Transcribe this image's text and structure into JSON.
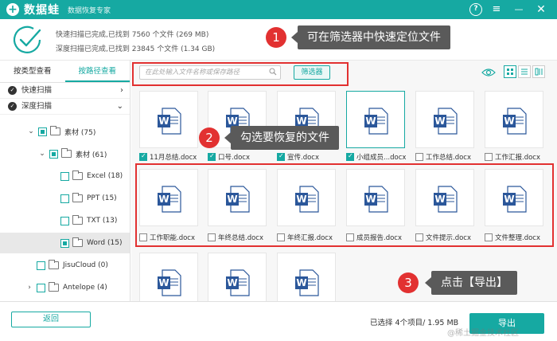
{
  "app": {
    "name": "数据蛙",
    "subtitle": "数据恢复专家"
  },
  "window_controls": {
    "help": "?",
    "menu": "≡",
    "minimize": "—",
    "close": "✕"
  },
  "summary": {
    "quick_scan": "快速扫描已完成,已找到 7560 个文件 (269 MB)",
    "deep_scan": "深度扫描已完成,已找到 23845 个文件 (1.34 GB)"
  },
  "callouts": [
    {
      "number": "1",
      "text": "可在筛选器中快速定位文件"
    },
    {
      "number": "2",
      "text": "勾选要恢复的文件"
    },
    {
      "number": "3",
      "text": "点击【导出】"
    }
  ],
  "left": {
    "tabs": [
      "按类型查看",
      "按路径查看"
    ],
    "active_tab": 1,
    "scans": [
      {
        "label": "快速扫描",
        "chevron": "›"
      },
      {
        "label": "深度扫描",
        "chevron": "⌄"
      }
    ],
    "tree": [
      {
        "label": "素材 (75)",
        "arrow": "⌄",
        "state": "partial"
      },
      {
        "label": "素材 (61)",
        "arrow": "⌄",
        "state": "partial"
      },
      {
        "label": "Excel (18)",
        "arrow": "",
        "state": "none"
      },
      {
        "label": "PPT (15)",
        "arrow": "",
        "state": "none"
      },
      {
        "label": "TXT (13)",
        "arrow": "",
        "state": "none"
      },
      {
        "label": "Word (15)",
        "arrow": "",
        "state": "partial"
      },
      {
        "label": "JisuCloud (0)",
        "arrow": "",
        "state": "none"
      },
      {
        "label": "Antelope (4)",
        "arrow": "›",
        "state": "none"
      }
    ]
  },
  "toolbar": {
    "search_placeholder": "在此处输入文件名称或保存路径",
    "filter_label": "筛选器"
  },
  "files_row1": [
    {
      "name": "11月总结.docx",
      "checked": true
    },
    {
      "name": "口号.docx",
      "checked": true
    },
    {
      "name": "宣传.docx",
      "checked": true
    },
    {
      "name": "小组成员...docx",
      "checked": true
    },
    {
      "name": "工作总结.docx",
      "checked": false
    },
    {
      "name": "工作汇报.docx",
      "checked": false
    }
  ],
  "files_row2": [
    {
      "name": "工作职能.docx",
      "checked": false
    },
    {
      "name": "年终总结.docx",
      "checked": false
    },
    {
      "name": "年终汇报.docx",
      "checked": false
    },
    {
      "name": "成员报告.docx",
      "checked": false
    },
    {
      "name": "文件提示.docx",
      "checked": false
    },
    {
      "name": "文件整理.docx",
      "checked": false
    }
  ],
  "bottom": {
    "back_label": "返回",
    "selected_info": "已选择 4个项目/ 1.95 MB",
    "export_label": "导出",
    "watermark": "@稀土掘金技术社区"
  },
  "colors": {
    "accent": "#16a9a2",
    "callout_red": "#e23131",
    "word_blue": "#2b579a"
  }
}
